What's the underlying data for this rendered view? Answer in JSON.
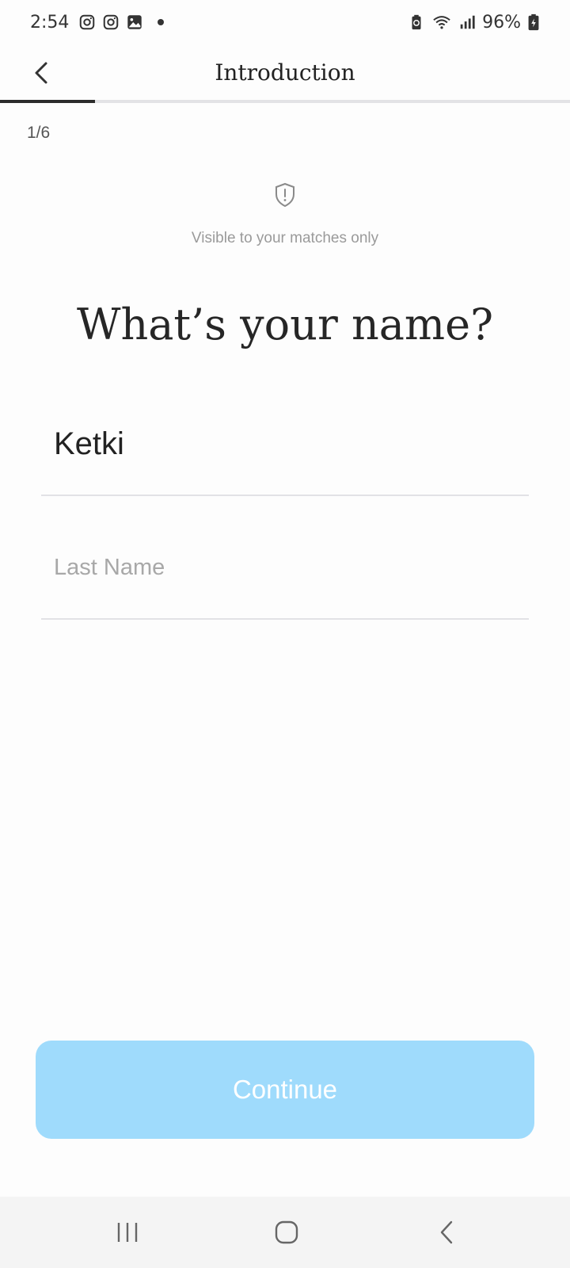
{
  "status_bar": {
    "time": "2:54",
    "battery": "96%",
    "left_icons": [
      "instagram-icon",
      "instagram-icon",
      "gallery-icon",
      "notification-dot"
    ],
    "right_icons": [
      "battery-saver-icon",
      "wifi-icon",
      "signal-icon",
      "battery-charging-icon"
    ]
  },
  "header": {
    "title": "Introduction",
    "back_icon": "chevron-left-icon"
  },
  "progress": {
    "current_step": 1,
    "total_steps": 6,
    "fraction": 0.1667,
    "label": "1/6"
  },
  "privacy": {
    "icon": "shield-alert-icon",
    "note": "Visible to your matches only"
  },
  "form": {
    "question": "What’s your name?",
    "first_name_value": "Ketki",
    "last_name_placeholder": "Last Name"
  },
  "actions": {
    "continue_label": "Continue"
  },
  "colors": {
    "continue_bg": "#9fdbfc",
    "progress_fill": "#2b2b2b",
    "progress_track": "#e3e3e6"
  },
  "nav_bar": {
    "icons": [
      "recent-apps-icon",
      "home-icon",
      "back-icon"
    ]
  }
}
